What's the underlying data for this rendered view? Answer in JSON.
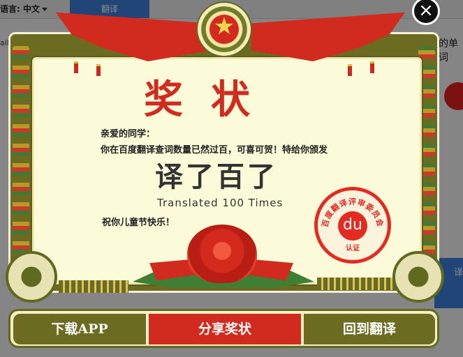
{
  "background": {
    "language_label": "语言: 中文",
    "translate_button": "翻译",
    "word_hint": "的单词",
    "left_snippet": "ail",
    "blue_tab_text": "译"
  },
  "certificate": {
    "title": "奖状",
    "greeting": "亲爱的同学：",
    "body": "你在百度翻译查词数量已然过百，可喜可贺！特给你颁发",
    "award_title": "译了百了",
    "award_subtitle": "Translated 100 Times",
    "blessing": "祝你儿童节快乐！",
    "stamp": {
      "arc_text": "百度翻译评审委员会",
      "bottom_text": "认证",
      "logo": "du"
    }
  },
  "close_icon": "×",
  "actions": {
    "download": "下载APP",
    "share": "分享奖状",
    "back": "回到翻译"
  },
  "colors": {
    "olive": "#6b6b22",
    "red": "#d12a1e",
    "paper": "#fbfbd9"
  }
}
